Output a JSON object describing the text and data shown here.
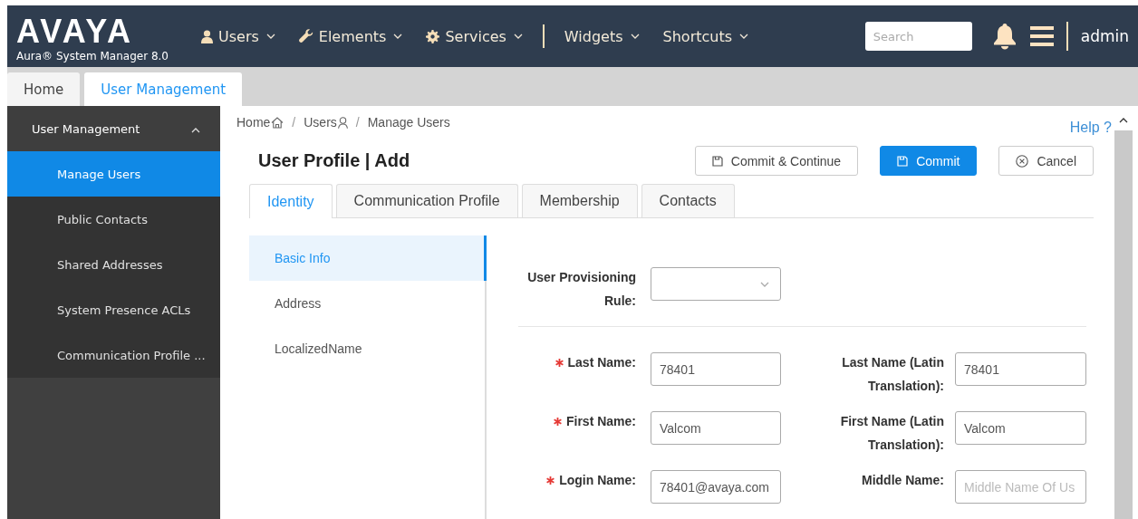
{
  "header": {
    "logo": "AVAYA",
    "subtitle": "Aura® System Manager 8.0",
    "menu_groups": [
      [
        {
          "label": "Users"
        },
        {
          "label": "Elements"
        },
        {
          "label": "Services"
        }
      ],
      [
        {
          "label": "Widgets"
        },
        {
          "label": "Shortcuts"
        }
      ]
    ],
    "search": {
      "placeholder": "Search"
    },
    "user": "admin"
  },
  "tabs": [
    {
      "label": "Home",
      "selected": false
    },
    {
      "label": "User Management",
      "selected": true
    }
  ],
  "sidebar": {
    "title": "User Management",
    "expanded": true,
    "items": [
      {
        "label": "Manage Users",
        "selected": true
      },
      {
        "label": "Public Contacts",
        "selected": false
      },
      {
        "label": "Shared Addresses",
        "selected": false
      },
      {
        "label": "System Presence ACLs",
        "selected": false
      },
      {
        "label": "Communication Profile ...",
        "selected": false
      }
    ]
  },
  "breadcrumb": [
    {
      "kind": "home",
      "label": "Home"
    },
    {
      "kind": "separator",
      "label": "/"
    },
    {
      "kind": "users",
      "label": "Users"
    },
    {
      "kind": "separator",
      "label": "/"
    },
    {
      "kind": "page",
      "label": "Manage Users"
    }
  ],
  "help": "Help ?",
  "title": "User Profile | Add",
  "buttons": [
    {
      "label": "Commit & Continue",
      "kind": "secondary"
    },
    {
      "label": "Commit",
      "kind": "primary"
    },
    {
      "label": "Cancel",
      "kind": "cancel"
    }
  ],
  "form_tabs": [
    {
      "label": "Identity",
      "selected": true
    },
    {
      "label": "Communication Profile",
      "selected": false
    },
    {
      "label": "Membership",
      "selected": false
    },
    {
      "label": "Contacts",
      "selected": false
    }
  ],
  "sections": [
    {
      "label": "Basic Info",
      "selected": true
    },
    {
      "label": "Address",
      "selected": false
    },
    {
      "label": "LocalizedName",
      "selected": false
    }
  ],
  "provisioning": {
    "label": "User Provisioning Rule:"
  },
  "fields": [
    {
      "label": "Last Name:",
      "required": true,
      "value": "78401",
      "label_2": "Last Name (Latin Translation):",
      "value_2": "78401"
    },
    {
      "label": "First Name:",
      "required": true,
      "value": "Valcom",
      "label_2": "First Name (Latin Translation):",
      "value_2": "Valcom"
    },
    {
      "label": "Login Name:",
      "required": true,
      "value": "78401@avaya.com",
      "label_2": "Middle Name:",
      "placeholder_2": "Middle Name Of Us"
    }
  ]
}
